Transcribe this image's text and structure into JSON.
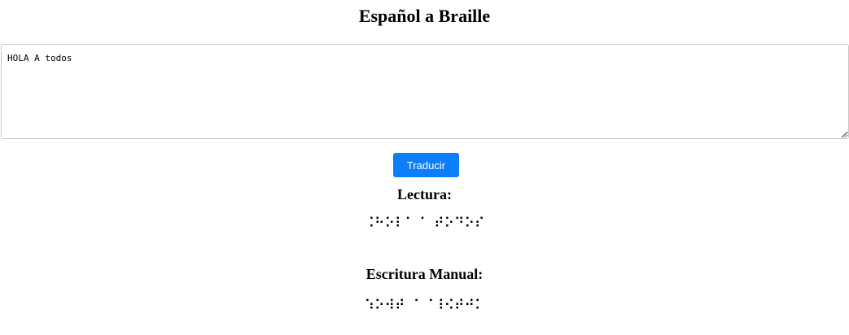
{
  "page": {
    "title": "Español a Braille"
  },
  "input": {
    "value": "HOLA A todos"
  },
  "actions": {
    "translate_label": "Traducir"
  },
  "reading": {
    "heading": "Lectura:",
    "braille": "⠨⠓⠕⠇⠁ ⠁ ⠞⠕⠙⠕⠎"
  },
  "writing": {
    "heading": "Escritura Manual:",
    "braille": "⠱⠕⠺⠞ ⠈ ⠈⠸⠪⠞⠚⠅"
  },
  "colors": {
    "button_bg": "#0d7ef9",
    "button_text": "#ffffff",
    "border": "#c8c8c8"
  }
}
